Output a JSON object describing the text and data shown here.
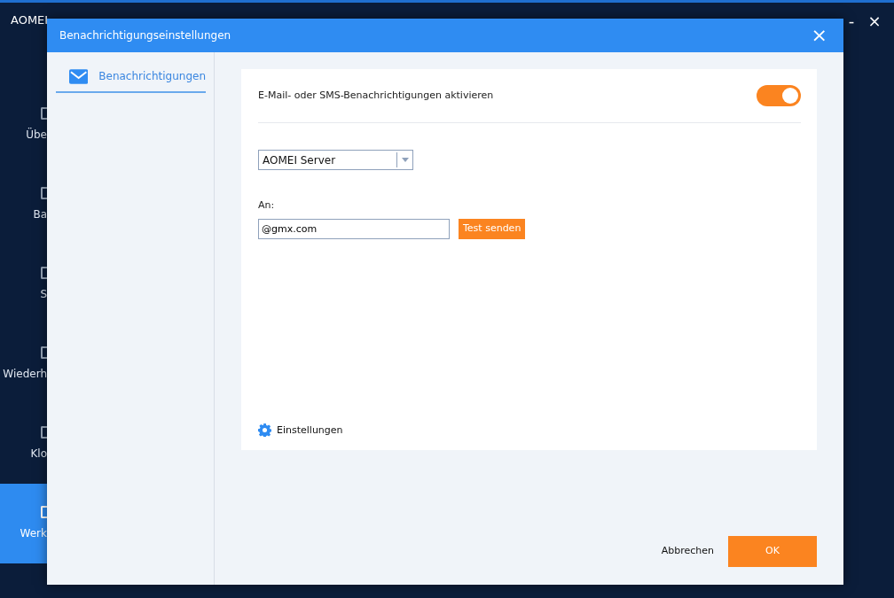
{
  "app": {
    "title": "AOMEI",
    "window_controls": [
      "-",
      "×"
    ],
    "sidebar": [
      {
        "label": "Übe",
        "selected": false
      },
      {
        "label": "Ba",
        "selected": false
      },
      {
        "label": "S",
        "selected": false
      },
      {
        "label": "Wiederh",
        "selected": false
      },
      {
        "label": "Klo",
        "selected": false
      },
      {
        "label": "Werk",
        "selected": true
      }
    ]
  },
  "dialog": {
    "title": "Benachrichtigungseinstellungen",
    "close": "×",
    "nav": [
      {
        "label": "Benachrichtigungen",
        "selected": true
      }
    ],
    "toggle": {
      "label": "E-Mail- oder SMS-Benachrichtigungen aktivieren",
      "on": true
    },
    "server_select": {
      "value": "AOMEI Server"
    },
    "to": {
      "label": "An:",
      "value": "@gmx.com"
    },
    "test_button": "Test senden",
    "settings_link": "Einstellungen",
    "buttons": {
      "cancel": "Abbrechen",
      "ok": "OK"
    }
  }
}
